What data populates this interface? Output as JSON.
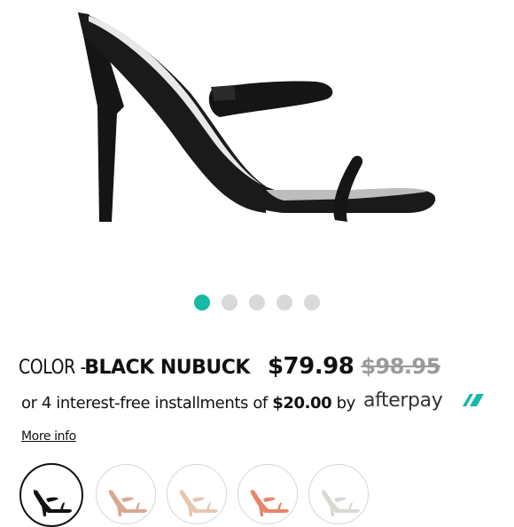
{
  "product": {
    "image_icon": "black-strappy-sandal-image",
    "carousel": {
      "count": 5,
      "active_index": 0
    },
    "color_prefix": "COLOR -",
    "color_name": "BLACK NUBUCK",
    "price": "$79.98",
    "original_price": "$98.95"
  },
  "afterpay": {
    "prefix": "or 4 interest-free installments of",
    "amount": "$20.00",
    "by": "by",
    "logo_text": "afterpay",
    "more_info": "More info"
  },
  "swatches": [
    {
      "name": "black",
      "color": "#111111",
      "selected": true
    },
    {
      "name": "blush",
      "color": "#d8a890",
      "selected": false
    },
    {
      "name": "nude",
      "color": "#e4c7b3",
      "selected": false
    },
    {
      "name": "orange",
      "color": "#e8866a",
      "selected": false
    },
    {
      "name": "white",
      "color": "#d9d9d3",
      "selected": false
    }
  ],
  "colors": {
    "accent": "#17b8a6",
    "inactive_dot": "#d9d9d9",
    "strike": "#9a9a9a"
  }
}
